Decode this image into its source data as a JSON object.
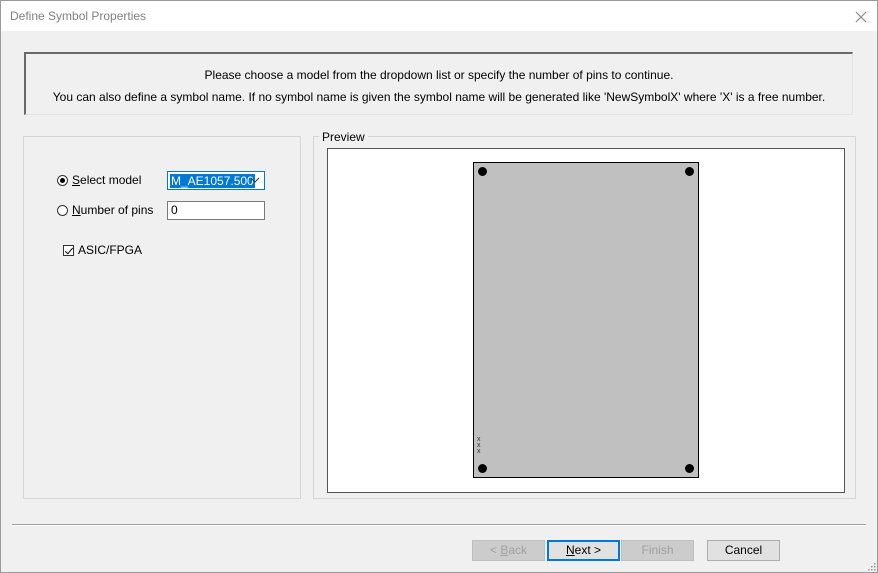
{
  "window": {
    "title": "Define Symbol Properties"
  },
  "info": {
    "line1": "Please choose a model from the dropdown list or specify the number of pins to continue.",
    "line2": "You can also define a symbol name. If no symbol name is given the symbol name will be generated like 'NewSymbolX' where 'X' is a free number."
  },
  "options": {
    "select_model_label_u": "S",
    "select_model_label_rest": "elect model",
    "select_model_checked": true,
    "model_value": "M_AE1057.500",
    "number_of_pins_label_u": "N",
    "number_of_pins_label_rest": "umber of pins",
    "number_of_pins_checked": false,
    "pins_value": "0",
    "asic_fpga_label": "ASIC/FPGA",
    "asic_fpga_checked": true
  },
  "preview": {
    "label": "Preview",
    "symbol_text": "xxx",
    "symbol_fill": "#c0c0c0"
  },
  "buttons": {
    "back_prefix": "< ",
    "back_u": "B",
    "back_rest": "ack",
    "next_u": "N",
    "next_rest": "ext >",
    "finish": "Finish",
    "cancel": "Cancel"
  },
  "colors": {
    "accent": "#0078d7",
    "background": "#f0f0f0"
  }
}
